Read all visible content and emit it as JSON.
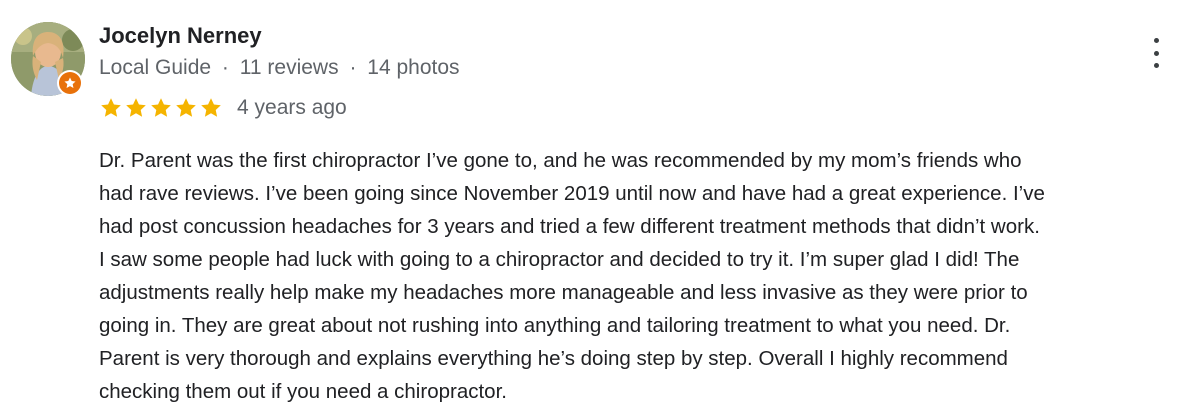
{
  "review": {
    "author_name": "Jocelyn Nerney",
    "author_role": "Local Guide",
    "review_count": "11 reviews",
    "photo_count": "14 photos",
    "separator": "·",
    "rating": 5,
    "max_rating": 5,
    "date": "4 years ago",
    "text_lines": [
      "Dr. Parent was the first chiropractor I’ve gone to, and he was recommended by my mom’s friends who",
      "had rave reviews. I’ve been going since November 2019 until now and have had a great experience. I’ve",
      "had post concussion headaches for 3 years and tried a few different treatment methods that didn’t work.",
      "I saw some people had luck with going to a chiropractor and decided to try it. I’m super glad I did! The",
      "adjustments really help make my headaches more manageable and less invasive as they were prior to",
      "going in. They are great about not rushing into anything and tailoring treatment to what you need. Dr.",
      "Parent is very thorough and explains everything he’s doing step by step. Overall I highly recommend",
      "checking them out if you need a chiropractor."
    ]
  },
  "icons": {
    "avatar": "profile-photo",
    "badge": "local-guide-star-icon",
    "star": "star-icon",
    "more": "more-vert-icon"
  },
  "colors": {
    "star": "#f5b400",
    "badge": "#e8710a",
    "meta_text": "#5f6368",
    "body_text": "#202124"
  }
}
